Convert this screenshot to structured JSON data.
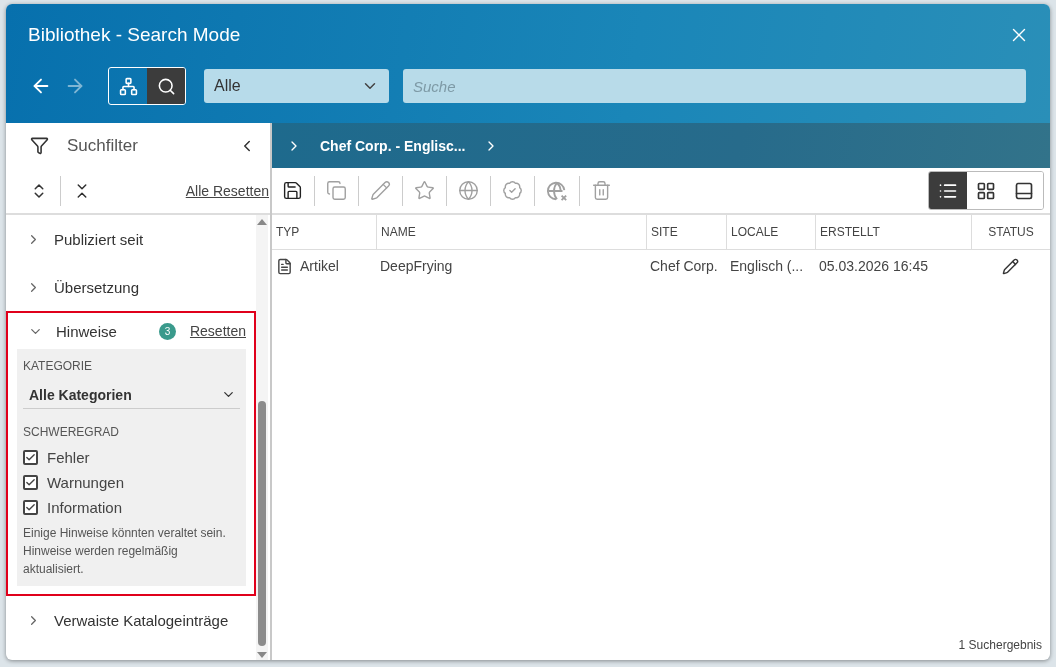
{
  "window": {
    "title": "Bibliothek - Search Mode"
  },
  "nav": {
    "back_disabled": false,
    "forward_disabled": true
  },
  "mode_toggle": [
    {
      "kind": "tree",
      "selected": false
    },
    {
      "kind": "search",
      "selected": true
    }
  ],
  "scope_select": {
    "value": "Alle"
  },
  "search": {
    "placeholder": "Suche"
  },
  "sidebar": {
    "title": "Suchfilter",
    "reset_all": "Alle Resetten",
    "filters": [
      {
        "kind": "collapsed",
        "label": "Publiziert seit",
        "expanded": false,
        "highlighted": false
      },
      {
        "kind": "collapsed",
        "label": "Übersetzung",
        "expanded": false,
        "highlighted": false
      },
      {
        "kind": "notes",
        "label": "Hinweise",
        "expanded": true,
        "highlighted": true,
        "badge": "3",
        "reset": "Resetten",
        "category_label": "KATEGORIE",
        "category_value": "Alle Kategorien",
        "severity_label": "SCHWEREGRAD",
        "severities": [
          {
            "label": "Fehler",
            "checked": true
          },
          {
            "label": "Warnungen",
            "checked": true
          },
          {
            "label": "Information",
            "checked": true
          }
        ],
        "note": "Einige Hinweise könnten veraltet sein. Hinweise werden regelmäßig aktualisiert."
      },
      {
        "kind": "collapsed",
        "label": "Verwaiste Katalogeinträge",
        "expanded": false,
        "highlighted": false
      }
    ]
  },
  "breadcrumb": {
    "label": "Chef Corp. - Englisc..."
  },
  "toolbar": {
    "actions": [
      {
        "kind": "save",
        "disabled": false
      },
      {
        "kind": "copy",
        "disabled": true
      },
      {
        "kind": "edit",
        "disabled": true
      },
      {
        "kind": "favorite",
        "disabled": true
      },
      {
        "kind": "publish",
        "disabled": true
      },
      {
        "kind": "approve",
        "disabled": true
      },
      {
        "kind": "unpublish",
        "disabled": true
      },
      {
        "kind": "delete",
        "disabled": true
      }
    ],
    "views": [
      {
        "kind": "list",
        "selected": true
      },
      {
        "kind": "grid",
        "selected": false
      },
      {
        "kind": "preview",
        "selected": false
      }
    ]
  },
  "table": {
    "columns": [
      "TYP",
      "NAME",
      "SITE",
      "LOCALE",
      "ERSTELLT",
      "STATUS"
    ],
    "rows": [
      {
        "type": "Artikel",
        "name": "DeepFrying",
        "site": "Chef Corp.",
        "locale": "Englisch (...",
        "created": "05.03.2026 16:45",
        "editable": true
      }
    ]
  },
  "status_bar": {
    "count": "1 Suchergebnis"
  }
}
